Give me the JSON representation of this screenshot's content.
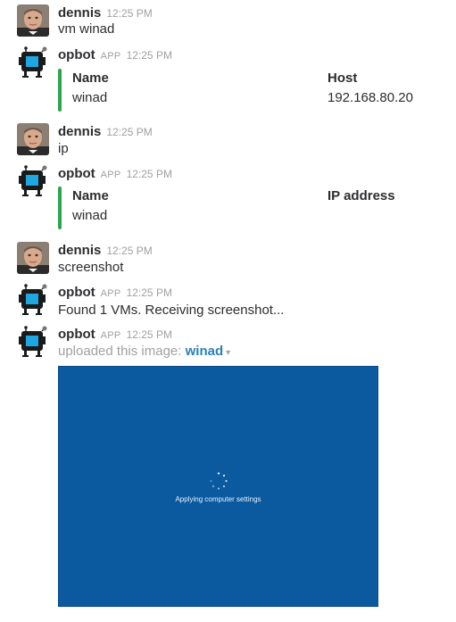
{
  "messages": [
    {
      "author": "dennis",
      "time": "12:25 PM",
      "text": "vm winad"
    },
    {
      "author": "opbot",
      "app_tag": "APP",
      "time": "12:25 PM",
      "fields": [
        {
          "title": "Name",
          "value": "winad"
        },
        {
          "title": "Host",
          "value": "192.168.80.20"
        }
      ]
    },
    {
      "author": "dennis",
      "time": "12:25 PM",
      "text": "ip"
    },
    {
      "author": "opbot",
      "app_tag": "APP",
      "time": "12:25 PM",
      "fields": [
        {
          "title": "Name",
          "value": "winad"
        },
        {
          "title": "IP address",
          "value": ""
        }
      ]
    },
    {
      "author": "dennis",
      "time": "12:25 PM",
      "text": "screenshot"
    },
    {
      "author": "opbot",
      "app_tag": "APP",
      "time": "12:25 PM",
      "text": "Found 1 VMs. Receiving screenshot..."
    },
    {
      "author": "opbot",
      "app_tag": "APP",
      "time": "12:25 PM",
      "upload": {
        "prefix": "uploaded this image:",
        "file_name": "winad",
        "caret": "▾"
      },
      "screenshot_text": "Applying computer settings"
    }
  ],
  "colors": {
    "attachment_bar": "#2fa44f",
    "link": "#2a80b9",
    "screenshot_bg": "#0b5aa0",
    "bot_icon": "#1ea7e1"
  },
  "icons": {
    "user_avatar": "person-photo",
    "bot_avatar": "robot-icon",
    "spinner": "loading-spinner-icon",
    "menu": "chevron-down-icon"
  }
}
